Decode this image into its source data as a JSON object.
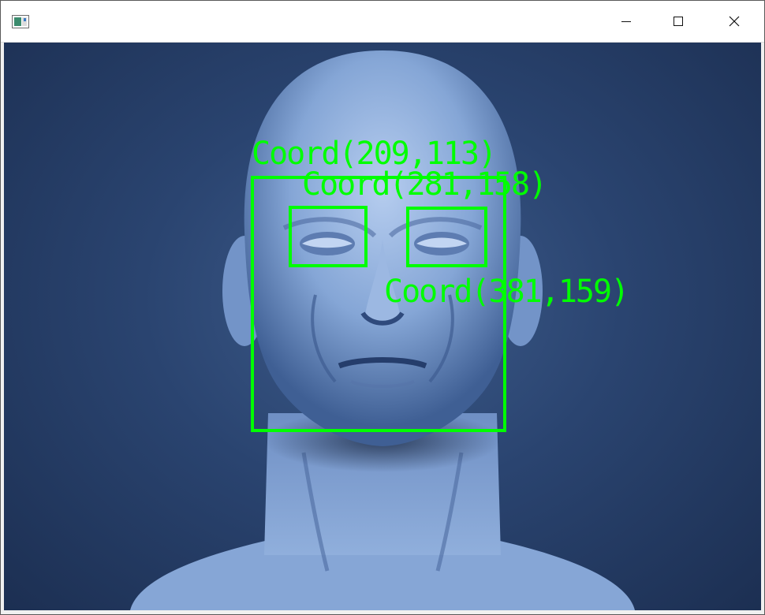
{
  "window": {
    "app_icon": "window-app-icon",
    "controls": {
      "minimize_icon": "minimize-icon",
      "maximize_icon": "maximize-icon",
      "close_icon": "close-icon"
    }
  },
  "detections": {
    "face": {
      "label": "Coord(209,113)"
    },
    "eyes": [
      {
        "label": "Coord(281,158)"
      },
      {
        "label": "Coord(381,159)"
      }
    ]
  },
  "colors": {
    "overlay": "#00ff00",
    "background_dark": "#1c2f52",
    "background_mid": "#3d5b8a",
    "skin": "#8fb0dc"
  }
}
